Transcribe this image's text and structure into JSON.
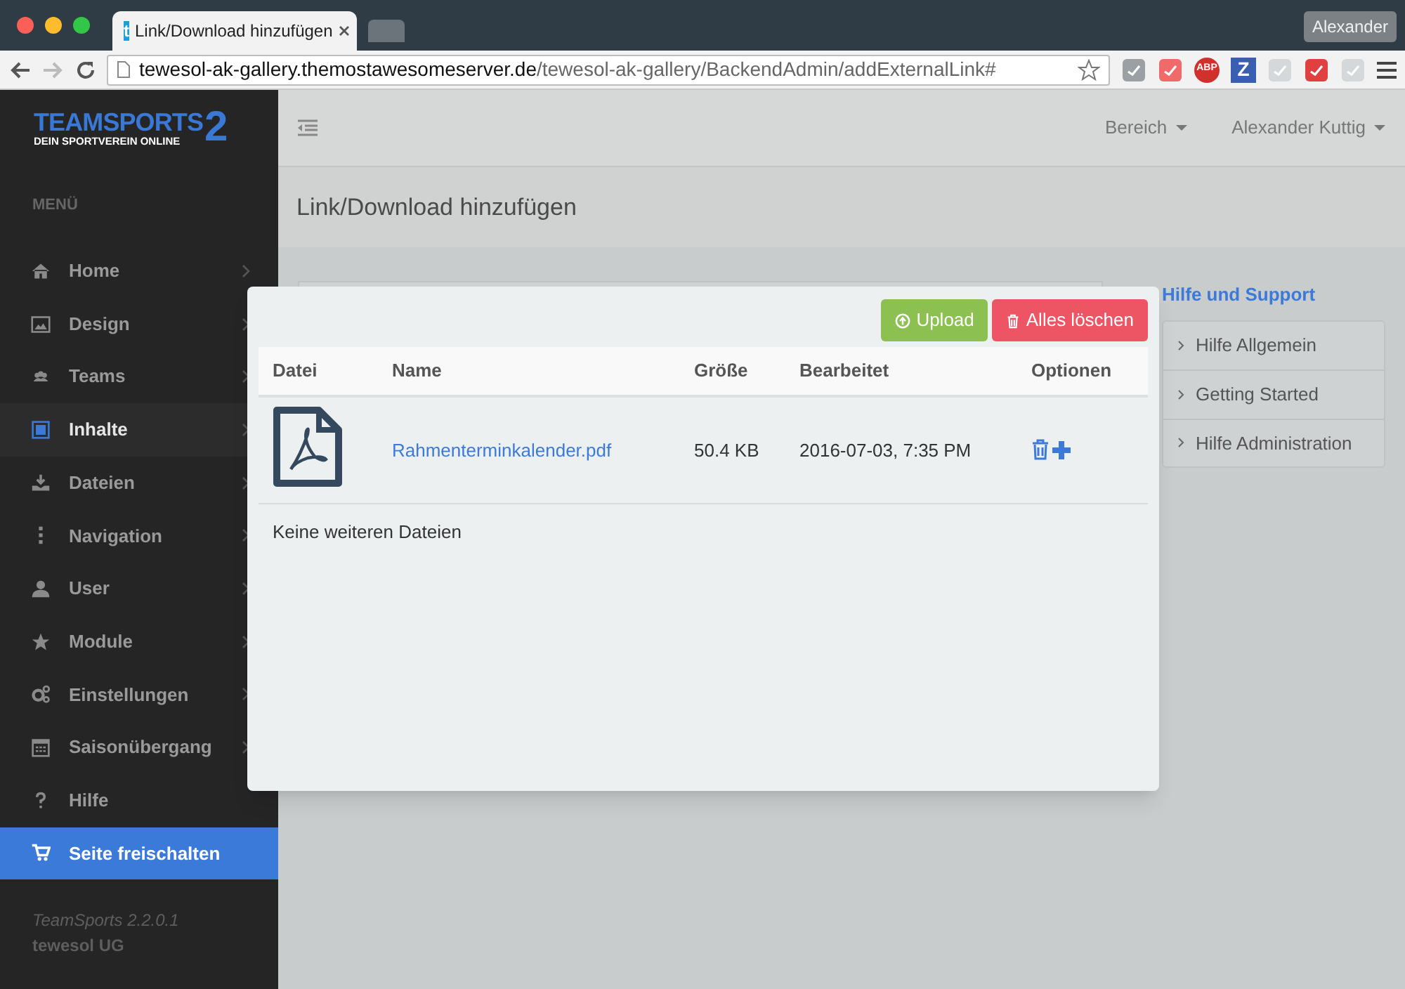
{
  "browser": {
    "tabs": [
      {
        "title": "Link/Download hinzufügen",
        "favicon": "t",
        "selected": true
      },
      {
        "selected": false
      }
    ],
    "profile": "Alexander",
    "url_host": "tewesol-ak-gallery.themostawesomeserver.de",
    "url_path": "/tewesol-ak-gallery/BackendAdmin/addExternalLink#",
    "extensions": [
      {
        "kind": "icon"
      },
      {
        "kind": "icon"
      },
      {
        "kind": "text",
        "label": "ABP"
      },
      {
        "kind": "text",
        "label": "Z"
      },
      {
        "kind": "icon"
      },
      {
        "kind": "icon"
      },
      {
        "kind": "icon"
      }
    ]
  },
  "logo": {
    "line1": "TEAMSPORTS",
    "digit": "2",
    "line2": "DEIN SPORTVEREIN ONLINE"
  },
  "sidebar": {
    "heading": "MENÜ",
    "items": [
      {
        "label": "Home",
        "selected": false,
        "submenu": true,
        "kind": "normal"
      },
      {
        "label": "Design",
        "selected": false,
        "submenu": true,
        "kind": "normal"
      },
      {
        "label": "Teams",
        "selected": false,
        "submenu": true,
        "kind": "normal"
      },
      {
        "label": "Inhalte",
        "selected": true,
        "submenu": true,
        "kind": "normal"
      },
      {
        "label": "Dateien",
        "selected": false,
        "submenu": true,
        "kind": "normal"
      },
      {
        "label": "Navigation",
        "selected": false,
        "submenu": true,
        "kind": "normal"
      },
      {
        "label": "User",
        "selected": false,
        "submenu": true,
        "kind": "normal"
      },
      {
        "label": "Module",
        "selected": false,
        "submenu": true,
        "kind": "normal"
      },
      {
        "label": "Einstellungen",
        "selected": false,
        "submenu": true,
        "kind": "normal"
      },
      {
        "label": "Saisonübergang",
        "selected": false,
        "submenu": true,
        "kind": "normal"
      },
      {
        "label": "Hilfe",
        "selected": false,
        "submenu": false,
        "kind": "normal"
      },
      {
        "label": "Seite freischalten",
        "selected": false,
        "submenu": false,
        "kind": "cta"
      }
    ],
    "version": "TeamSports 2.2.0.1",
    "company": "tewesol UG"
  },
  "topbar": {
    "menus": [
      "Bereich",
      "Alexander Kuttig"
    ]
  },
  "page_title": "Link/Download hinzufügen",
  "help": {
    "title": "Hilfe und Support",
    "links": [
      "Hilfe Allgemein",
      "Getting Started",
      "Hilfe Administration"
    ]
  },
  "modal": {
    "buttons": [
      {
        "label": "Upload",
        "kind": "upload"
      },
      {
        "label": "Alles löschen",
        "kind": "delete"
      }
    ],
    "columns": [
      "Datei",
      "Name",
      "Größe",
      "Bearbeitet",
      "Optionen"
    ],
    "rows": [
      {
        "name": "Rahmenterminkalender.pdf",
        "size": "50.4 KB",
        "modified": "2016-07-03, 7:35 PM"
      }
    ],
    "footer": "Keine weiteren Dateien"
  }
}
